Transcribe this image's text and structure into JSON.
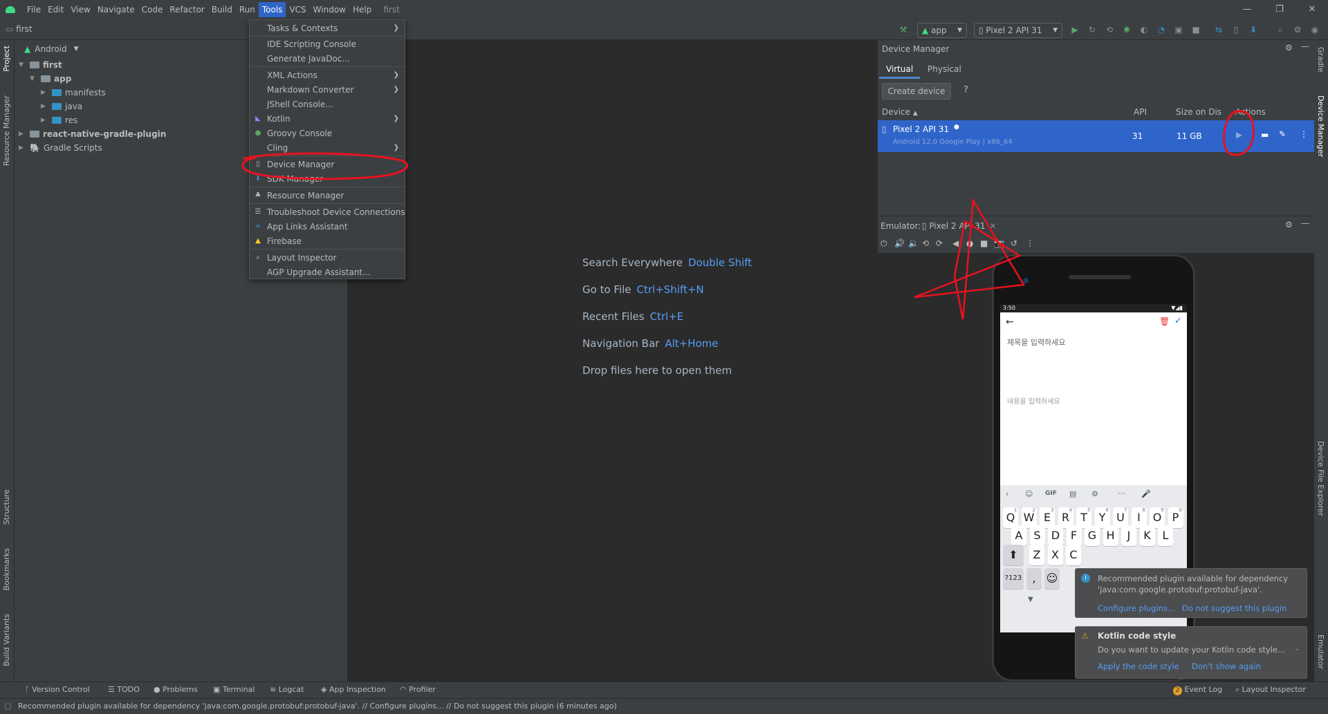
{
  "menubar": {
    "items": [
      "File",
      "Edit",
      "View",
      "Navigate",
      "Code",
      "Refactor",
      "Build",
      "Run",
      "Tools",
      "VCS",
      "Window",
      "Help"
    ],
    "project": "first"
  },
  "navbar": {
    "breadcrumb": "first",
    "run_config": "app",
    "device": "Pixel 2 API 31"
  },
  "left_strip": [
    "Project",
    "Resource Manager",
    "Structure",
    "Bookmarks",
    "Build Variants"
  ],
  "project_panel": {
    "view": "Android",
    "tree": [
      {
        "label": "first",
        "bold": true
      },
      {
        "label": "app",
        "bold": true
      },
      {
        "label": "manifests"
      },
      {
        "label": "java"
      },
      {
        "label": "res"
      },
      {
        "label": "react-native-gradle-plugin",
        "bold": true
      },
      {
        "label": "Gradle Scripts"
      }
    ]
  },
  "tools_menu": [
    "Tasks & Contexts",
    "IDE Scripting Console",
    "Generate JavaDoc...",
    "XML Actions",
    "Markdown Converter",
    "JShell Console...",
    "Kotlin",
    "Groovy Console",
    "Cling",
    "Device Manager",
    "SDK Manager",
    "Resource Manager",
    "Troubleshoot Device Connections",
    "App Links Assistant",
    "Firebase",
    "Layout Inspector",
    "AGP Upgrade Assistant..."
  ],
  "editor_hints": [
    {
      "text": "Search Everywhere",
      "key": "Double Shift"
    },
    {
      "text": "Go to File",
      "key": "Ctrl+Shift+N"
    },
    {
      "text": "Recent Files",
      "key": "Ctrl+E"
    },
    {
      "text": "Navigation Bar",
      "key": "Alt+Home"
    },
    {
      "text": "Drop files here to open them",
      "key": ""
    }
  ],
  "device_manager": {
    "title": "Device Manager",
    "tabs": [
      "Virtual",
      "Physical"
    ],
    "create_button": "Create device",
    "help": "?",
    "columns": [
      "Device",
      "API",
      "Size on Disk",
      "Actions"
    ],
    "device": {
      "name": "Pixel 2 API 31",
      "sub": "Android 12.0 Google Play | x86_64",
      "api": "31",
      "size": "11 GB"
    }
  },
  "emulator": {
    "label": "Emulator:",
    "tab": "Pixel 2 API 31",
    "status_time": "3:50",
    "title_placeholder": "제목을 입력하세요",
    "body_placeholder": "내용을 입력하세요",
    "kb_toolbar": [
      "GIF"
    ],
    "row1": [
      "Q",
      "W",
      "E",
      "R",
      "T",
      "Y",
      "U",
      "I",
      "O",
      "P"
    ],
    "row1_nums": [
      "1",
      "2",
      "3",
      "4",
      "5",
      "6",
      "7",
      "8",
      "9",
      "0"
    ],
    "row2": [
      "A",
      "S",
      "D",
      "F",
      "G",
      "H",
      "J",
      "K",
      "L"
    ],
    "row3": [
      "Z",
      "X",
      "C"
    ],
    "numkey": "?123",
    "comma": ","
  },
  "right_strip": [
    "Gradle",
    "Device Manager",
    "Device File Explorer",
    "Emulator"
  ],
  "notifications": {
    "plugin": {
      "text": "Recommended plugin available for dependency 'java:com.google.protobuf:protobuf-java'.",
      "link1": "Configure plugins...",
      "link2": "Do not suggest this plugin"
    },
    "kotlin": {
      "title": "Kotlin code style",
      "text": "Do you want to update your Kotlin code style...",
      "link1": "Apply the code style",
      "link2": "Don't show again"
    }
  },
  "bottom_tabs": [
    "Version Control",
    "TODO",
    "Problems",
    "Terminal",
    "Logcat",
    "App Inspection",
    "Profiler"
  ],
  "bottom_right": [
    "Event Log",
    "Layout Inspector"
  ],
  "event_count": "2",
  "status": "Recommended plugin available for dependency 'java:com.google.protobuf:protobuf-java'. // Configure plugins... // Do not suggest this plugin (6 minutes ago)",
  "colors": {
    "accent": "#2f65ca",
    "annotation": "#e8121f"
  }
}
